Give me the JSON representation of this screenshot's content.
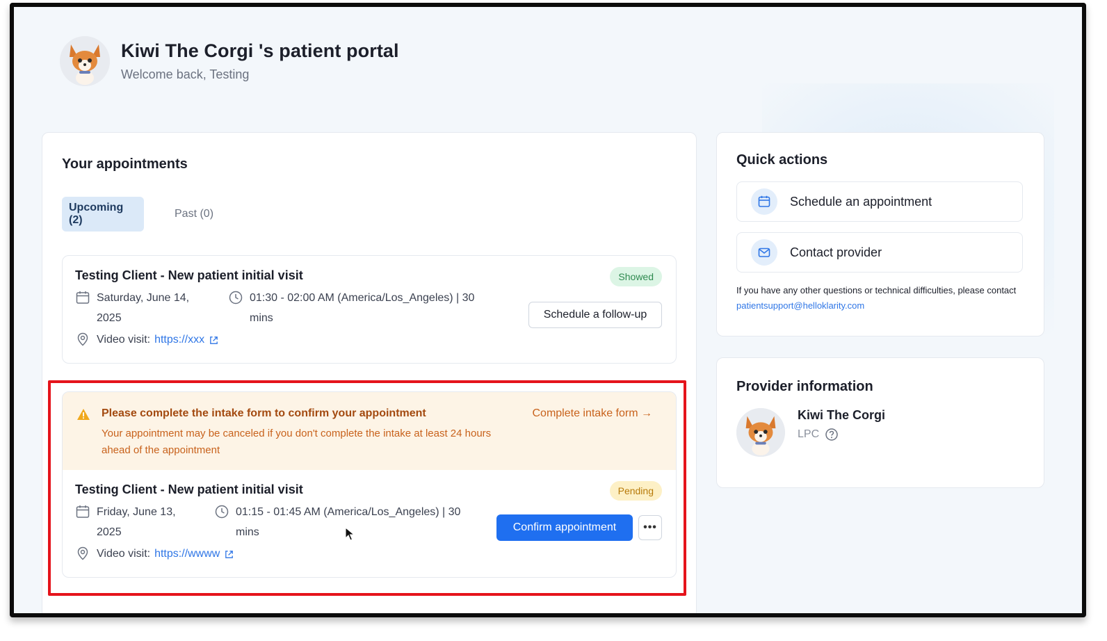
{
  "header": {
    "title": "Kiwi The Corgi 's patient portal",
    "subtitle": "Welcome back, Testing",
    "avatar_icon": "corgi-avatar"
  },
  "appointments": {
    "title": "Your appointments",
    "tabs": [
      {
        "label": "Upcoming (2)",
        "active": true
      },
      {
        "label": "Past (0)",
        "active": false
      }
    ],
    "items": [
      {
        "title": "Testing Client - New patient initial visit",
        "status": "Showed",
        "date_line1": "Saturday, June 14,",
        "date_line2": "2025",
        "time_line1": "01:30 - 02:00 AM (America/Los_Angeles) | 30",
        "time_line2": "mins",
        "video_label": "Video visit:",
        "video_link": "https://xxx",
        "action_label": "Schedule a follow-up"
      },
      {
        "alert": {
          "title": "Please complete the intake form to confirm your appointment",
          "body": "Your appointment may be canceled if you don't complete the intake at least 24 hours ahead of the appointment",
          "link": "Complete intake form →"
        },
        "title": "Testing Client - New patient initial visit",
        "status": "Pending",
        "date_line1": "Friday, June 13,",
        "date_line2": "2025",
        "time_line1": "01:15 - 01:45 AM (America/Los_Angeles) | 30",
        "time_line2": "mins",
        "video_label": "Video visit:",
        "video_link": "https://wwww",
        "action_label": "Confirm appointment",
        "more_label": "•••"
      }
    ]
  },
  "quick_actions": {
    "title": "Quick actions",
    "items": [
      {
        "label": "Schedule an appointment",
        "icon": "calendar-icon"
      },
      {
        "label": "Contact provider",
        "icon": "mail-icon"
      }
    ],
    "help_text": "If you have any other questions or technical difficulties, please contact",
    "help_email": "patientsupport@helloklarity.com"
  },
  "provider": {
    "title": "Provider information",
    "name": "Kiwi The Corgi",
    "credential": "LPC"
  },
  "colors": {
    "primary": "#1f6ff0",
    "link": "#2f76e6",
    "highlight": "#e5141b",
    "showed_bg": "#dcf5e5",
    "pending_bg": "#fdf0c6",
    "alert_bg": "#fdf4e6"
  }
}
